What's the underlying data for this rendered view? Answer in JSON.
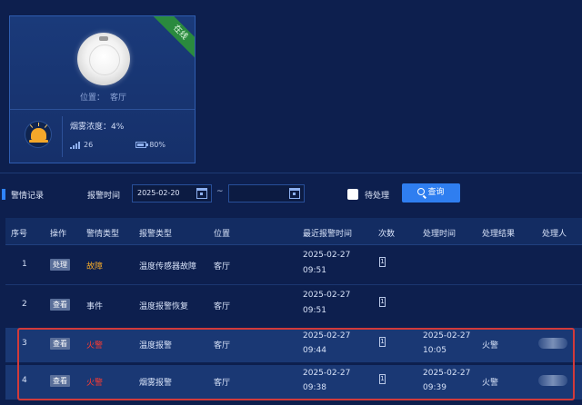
{
  "device_card": {
    "status_badge": "在线",
    "location_label": "位置：",
    "location_value": "客厅",
    "smoke_density_label": "烟雾浓度：",
    "smoke_density_value": "4%",
    "signal_value": "26",
    "battery_value": "80%"
  },
  "filter": {
    "section_title": "警情记录",
    "time_label": "报警时间",
    "start_date": "2025-02-20",
    "end_date": "",
    "separator": "~",
    "pending_label": "待处理",
    "pending_checked": false,
    "query_button": "查询"
  },
  "table": {
    "headers": [
      "序号",
      "操作",
      "警情类型",
      "报警类型",
      "位置",
      "最近报警时间",
      "次数",
      "处理时间",
      "处理结果",
      "处理人"
    ],
    "rows": [
      {
        "index": "1",
        "action": "处理",
        "alert_category": "故障",
        "alarm_type": "温度传感器故障",
        "location": "客厅",
        "last_alarm_date": "2025-02-27",
        "last_alarm_time": "09:51",
        "count": "1",
        "handle_date": "",
        "handle_time": "",
        "result": "",
        "handler": ""
      },
      {
        "index": "2",
        "action": "查看",
        "alert_category": "事件",
        "alarm_type": "温度报警恢复",
        "location": "客厅",
        "last_alarm_date": "2025-02-27",
        "last_alarm_time": "09:51",
        "count": "1",
        "handle_date": "",
        "handle_time": "",
        "result": "",
        "handler": ""
      },
      {
        "index": "3",
        "action": "查看",
        "alert_category": "火警",
        "alarm_type": "温度报警",
        "location": "客厅",
        "last_alarm_date": "2025-02-27",
        "last_alarm_time": "09:44",
        "count": "1",
        "handle_date": "2025-02-27",
        "handle_time": "10:05",
        "result": "火警",
        "handler": ""
      },
      {
        "index": "4",
        "action": "查看",
        "alert_category": "火警",
        "alarm_type": "烟雾报警",
        "location": "客厅",
        "last_alarm_date": "2025-02-27",
        "last_alarm_time": "09:38",
        "count": "1",
        "handle_date": "2025-02-27",
        "handle_time": "09:39",
        "result": "火警",
        "handler": ""
      }
    ]
  },
  "colors": {
    "background": "#0d1f4e",
    "accent": "#2f7ef0",
    "online": "#2a8a3e",
    "fire": "#ff3b30",
    "fault": "#f2a92a",
    "highlight_border": "#d23a3a"
  }
}
